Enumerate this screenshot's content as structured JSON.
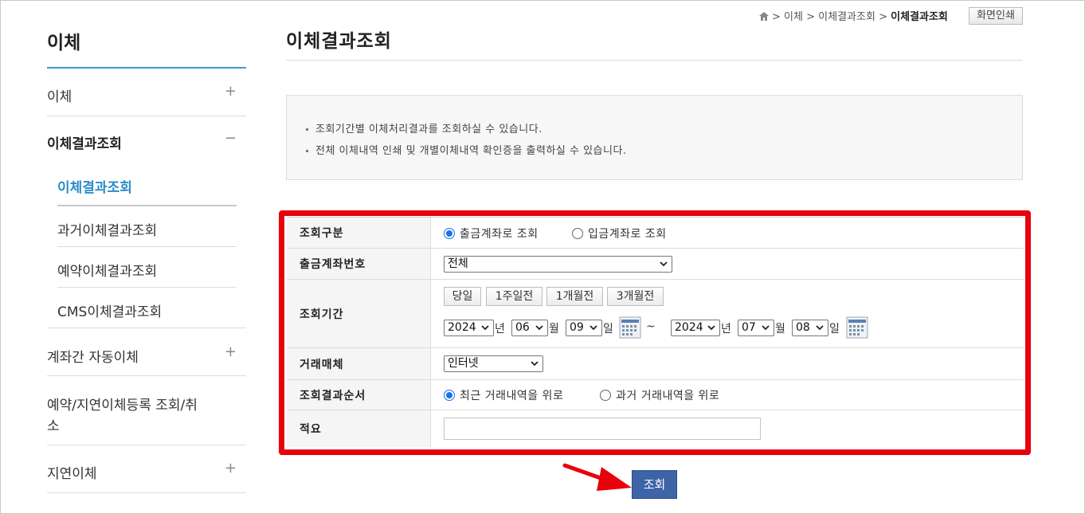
{
  "sidebar": {
    "title": "이체",
    "menu": [
      {
        "label": "이체",
        "toggle": "+"
      },
      {
        "label": "이체결과조회",
        "toggle": "−"
      },
      {
        "label": "계좌간 자동이체",
        "toggle": "+"
      },
      {
        "label": "예약/지연이체등록 조회/취",
        "label2": "소"
      },
      {
        "label": "지연이체",
        "toggle": "+"
      }
    ],
    "submenu": [
      "이체결과조회",
      "과거이체결과조회",
      "예약이체결과조회",
      "CMS이체결과조회"
    ]
  },
  "header": {
    "breadcrumb": [
      "이체",
      "이체결과조회",
      "이체결과조회"
    ],
    "sep": ">",
    "print_label": "화면인쇄",
    "title": "이체결과조회"
  },
  "info": [
    "조회기간별 이체처리결과를 조회하실 수 있습니다.",
    "전체 이체내역 인쇄 및 개별이체내역 확인증을 출력하실 수 있습니다."
  ],
  "form": {
    "type": {
      "label": "조회구분",
      "options": [
        "출금계좌로 조회",
        "입금계좌로 조회"
      ],
      "selected": 0
    },
    "account": {
      "label": "출금계좌번호",
      "value": "전체"
    },
    "period": {
      "label": "조회기간",
      "quick": [
        "당일",
        "1주일전",
        "1개월전",
        "3개월전"
      ],
      "from": {
        "year": "2024",
        "month": "06",
        "day": "09"
      },
      "to": {
        "year": "2024",
        "month": "07",
        "day": "08"
      },
      "units": {
        "year": "년",
        "month": "월",
        "day": "일"
      },
      "tilde": "~"
    },
    "media": {
      "label": "거래매체",
      "value": "인터넷"
    },
    "order": {
      "label": "조회결과순서",
      "options": [
        "최근 거래내역을 위로",
        "과거 거래내역을 위로"
      ],
      "selected": 0
    },
    "memo": {
      "label": "적요",
      "value": ""
    }
  },
  "search_label": "조회",
  "colors": {
    "accent": "#2a8cc9",
    "highlight": "#e8000b",
    "button": "#3e64a8"
  }
}
